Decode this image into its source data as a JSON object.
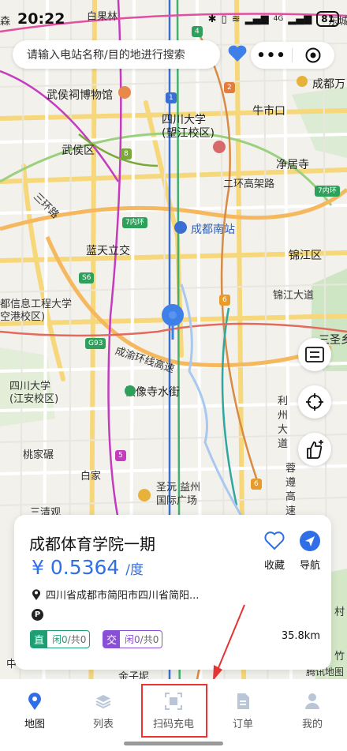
{
  "status_bar": {
    "time": "20:22",
    "battery": "81",
    "network": "4G"
  },
  "search": {
    "placeholder": "请输入电站名称/目的地进行搜索"
  },
  "capsule": {
    "more": "•••"
  },
  "map": {
    "labels": {
      "baiguolin": "白果林",
      "dongcheng": "东城",
      "sen": "森",
      "wuhouci": "武侯祠博物馆",
      "sichuan_wangjiang": "四川大学\n(望江校区)",
      "wuhou_district": "武侯区",
      "niushikou": "牛市口",
      "jingjusi": "净居寺",
      "erhuan": "二环高架路",
      "sanhuan": "三环路",
      "chengdu_south": "成都南站",
      "lantian": "蓝天立交",
      "jinjiang_district": "锦江区",
      "jinjiang_avenue": "锦江大道",
      "engineering_univ": "都信息工程大学\n空港校区)",
      "chengyu_ring": "成渝环线高速",
      "tiexiangsi": "铁像寺水街",
      "sanshengxiang": "三圣乡",
      "sichuan_jiangan": "四川大学\n(江安校区)",
      "lizhou_avenue": "利州大道",
      "rongdu_expressway": "蓉遵高速",
      "taojiawu": "桃家碾",
      "baijia": "白家",
      "shengcan_yizhou": "圣沅 益州\n国际广场",
      "sanqingxiang": "三清观",
      "cun": "村",
      "zhu": "竹",
      "zhong": "中",
      "jinzini": "金子坭",
      "tencent_map": "腾讯地图",
      "chengdu_wan": "成都万"
    },
    "road_shields": {
      "r4": "4",
      "r2": "2",
      "r1": "1",
      "r8": "8",
      "r7_west": "7内环",
      "r7_east": "7内环",
      "r6a": "6",
      "r6b": "6",
      "r5": "5",
      "s6": "S6",
      "g93": "G93"
    }
  },
  "station_card": {
    "name": "成都体育学院一期",
    "currency": "¥",
    "price": "0.5364",
    "price_unit": "/度",
    "favorite_label": "收藏",
    "navigate_label": "导航",
    "address": "四川省成都市简阳市四川省简阳...",
    "parking_badge": "P",
    "dc": {
      "type": "直",
      "free_label": "闲",
      "free": "0",
      "total_label": "/共",
      "total": "0"
    },
    "ac": {
      "type": "交",
      "free_label": "闲",
      "free": "0",
      "total_label": "/共",
      "total": "0"
    },
    "distance": "35.8km"
  },
  "tabs": [
    {
      "label": "地图",
      "icon": "map-pin-icon",
      "active": true
    },
    {
      "label": "列表",
      "icon": "layers-icon",
      "active": false
    },
    {
      "label": "扫码充电",
      "icon": "scan-icon",
      "active": false
    },
    {
      "label": "订单",
      "icon": "document-icon",
      "active": false
    },
    {
      "label": "我的",
      "icon": "user-icon",
      "active": false
    }
  ],
  "colors": {
    "accent": "#2f6ee6",
    "dc_green": "#1f9e74",
    "ac_purple": "#8a4fd6",
    "highlight": "#e33333"
  }
}
